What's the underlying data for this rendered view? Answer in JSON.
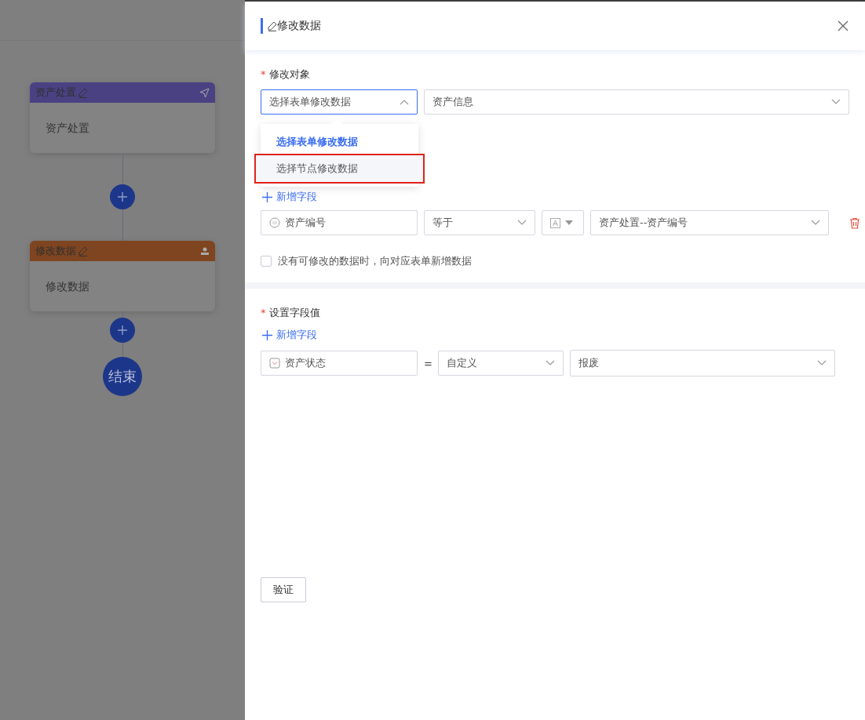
{
  "flow": {
    "nodes": [
      {
        "kind": "send",
        "title": "资产处置",
        "body": "资产处置",
        "color": "#4a4183"
      },
      {
        "kind": "person",
        "title": "修改数据",
        "body": "修改数据",
        "color": "#7e4520"
      },
      {
        "kind": "end",
        "title": "结束"
      }
    ]
  },
  "panel": {
    "title": "修改数据",
    "target": {
      "label": "修改对象",
      "marker": "*",
      "mode": "选择表单修改数据",
      "form": "资产信息",
      "open": true,
      "options": [
        {
          "label": "选择表单修改数据",
          "selected": true,
          "highlighted": false
        },
        {
          "label": "选择节点修改数据",
          "selected": false,
          "highlighted": true
        }
      ]
    },
    "conditions": {
      "add": "新增字段",
      "rows": [
        {
          "kind": "number",
          "field": "资产编号",
          "operator": "等于",
          "value": "资产处置--资产编号"
        }
      ],
      "fallback": {
        "label": "没有可修改的数据时，向对应表单新增数据",
        "checked": false
      }
    },
    "values": {
      "label": "设置字段值",
      "marker": "*",
      "add": "新增字段",
      "rows": [
        {
          "kind": "select",
          "field": "资产状态",
          "sign": "=",
          "mode": "自定义",
          "value": "报废"
        }
      ]
    },
    "verify": "验证"
  }
}
